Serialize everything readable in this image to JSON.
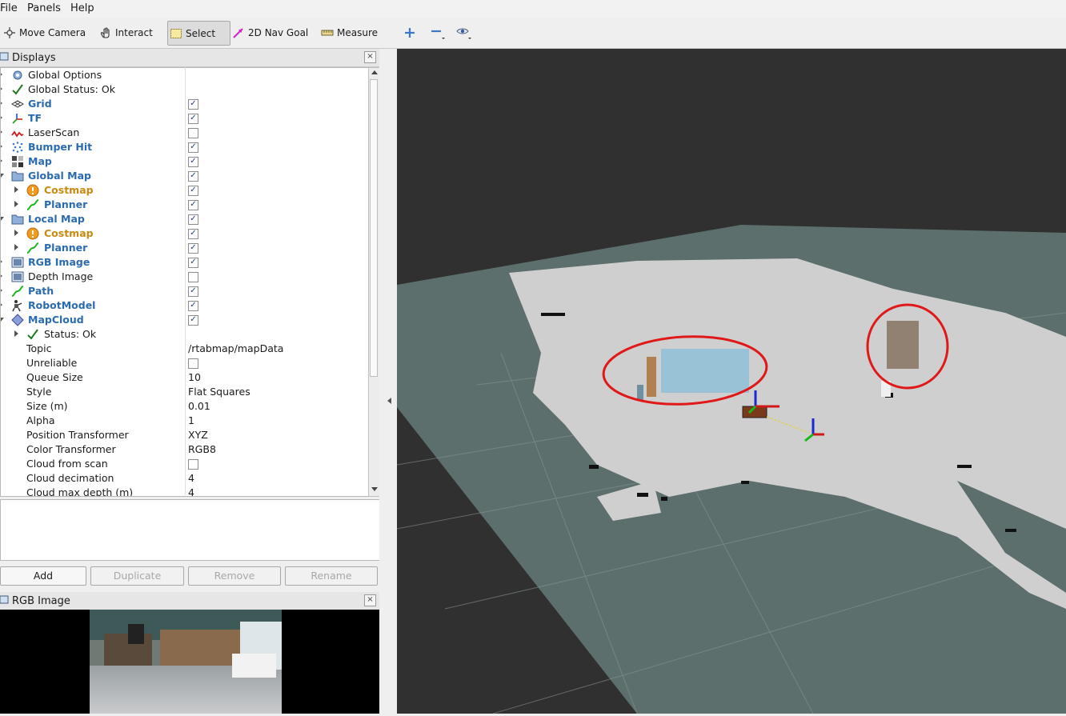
{
  "menubar": {
    "file": "File",
    "panels": "Panels",
    "help": "Help"
  },
  "toolbar": {
    "move_camera": "Move Camera",
    "interact": "Interact",
    "select": "Select",
    "nav_goal": "2D Nav Goal",
    "measure": "Measure"
  },
  "displays_panel": {
    "title": "Displays"
  },
  "tree": {
    "rows": [
      {
        "label": "Global Options"
      },
      {
        "label": "Global Status: Ok"
      },
      {
        "label": "Grid",
        "checked": "✓"
      },
      {
        "label": "TF",
        "checked": "✓"
      },
      {
        "label": "LaserScan",
        "checked": ""
      },
      {
        "label": "Bumper Hit",
        "checked": "✓"
      },
      {
        "label": "Map",
        "checked": "✓"
      },
      {
        "label": "Global Map",
        "checked": "✓"
      },
      {
        "label": "Costmap",
        "checked": "✓"
      },
      {
        "label": "Planner",
        "checked": "✓"
      },
      {
        "label": "Local Map",
        "checked": "✓"
      },
      {
        "label": "Costmap",
        "checked": "✓"
      },
      {
        "label": "Planner",
        "checked": "✓"
      },
      {
        "label": "RGB Image",
        "checked": "✓"
      },
      {
        "label": "Depth Image",
        "checked": ""
      },
      {
        "label": "Path",
        "checked": "✓"
      },
      {
        "label": "RobotModel",
        "checked": "✓"
      },
      {
        "label": "MapCloud",
        "checked": "✓"
      },
      {
        "label": "Status: Ok"
      }
    ],
    "properties": [
      {
        "label": "Topic",
        "value": "/rtabmap/mapData"
      },
      {
        "label": "Unreliable",
        "value": ""
      },
      {
        "label": "Queue Size",
        "value": "10"
      },
      {
        "label": "Style",
        "value": "Flat Squares"
      },
      {
        "label": "Size (m)",
        "value": "0.01"
      },
      {
        "label": "Alpha",
        "value": "1"
      },
      {
        "label": "Position Transformer",
        "value": "XYZ"
      },
      {
        "label": "Color Transformer",
        "value": "RGB8"
      },
      {
        "label": "Cloud from scan",
        "value": ""
      },
      {
        "label": "Cloud decimation",
        "value": "4"
      },
      {
        "label": "Cloud max depth (m)",
        "value": "4"
      }
    ]
  },
  "buttons": {
    "add": "Add",
    "duplicate": "Duplicate",
    "remove": "Remove",
    "rename": "Rename"
  },
  "rgb_panel": {
    "title": "RGB Image"
  },
  "colors": {
    "link_blue": "#2a6bb0",
    "warn_orange": "#c98a10",
    "viewport_bg": "#303030",
    "ground_plane": "#5c6f6d",
    "free_space": "#cfcfcf",
    "annotation_red": "#e01818"
  }
}
